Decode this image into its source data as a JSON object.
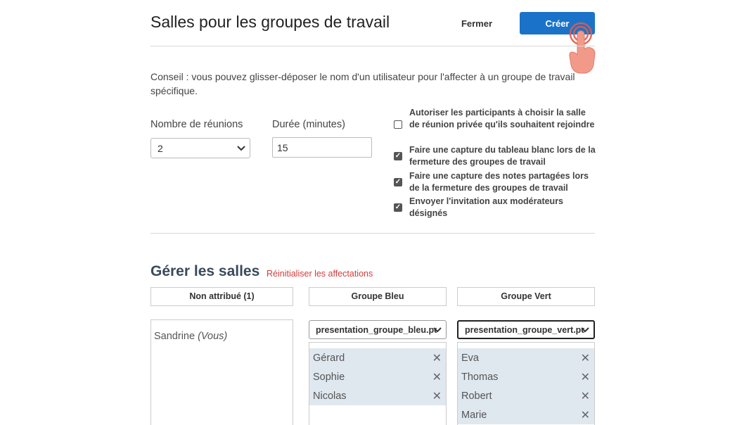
{
  "header": {
    "title": "Salles pour les groupes de travail",
    "close_label": "Fermer",
    "create_label": "Créer"
  },
  "tip": "Conseil : vous pouvez glisser-déposer le nom d'un utilisateur pour l'affecter à un groupe de travail spécifique.",
  "settings": {
    "meetings_label": "Nombre de réunions",
    "meetings_value": "2",
    "duration_label": "Durée (minutes)",
    "duration_value": "15",
    "options": [
      {
        "label": "Autoriser les participants à choisir la salle de réunion privée qu'ils souhaitent rejoindre",
        "checked": false
      },
      {
        "label": "Faire une capture du tableau blanc lors de la fermeture des groupes de travail",
        "checked": true
      },
      {
        "label": "Faire une capture des notes partagées lors de la fermeture des groupes de travail",
        "checked": true
      },
      {
        "label": "Envoyer l'invitation aux modérateurs désignés",
        "checked": true
      }
    ]
  },
  "manage": {
    "title": "Gérer les salles",
    "reset_label": "Réinitialiser les affectations",
    "unassigned": {
      "header": "Non attribué (1)",
      "name": "Sandrine",
      "suffix": "(Vous)"
    },
    "blue": {
      "header": "Groupe Bleu",
      "file": "presentation_groupe_bleu.pdf",
      "members": [
        "Gérard",
        "Sophie",
        "Nicolas"
      ]
    },
    "green": {
      "header": "Groupe Vert",
      "file": "presentation_groupe_vert.pdf",
      "members": [
        "Eva",
        "Thomas",
        "Robert",
        "Marie"
      ]
    }
  },
  "colors": {
    "accent": "#1a73c9",
    "reset": "#d23c3c",
    "member_bg": "#dfe7ef",
    "hand": "#f29a8a"
  },
  "icons": {
    "remove": "close-icon",
    "dropdown": "chevron-down-icon",
    "pointer": "pointing-hand-icon"
  }
}
